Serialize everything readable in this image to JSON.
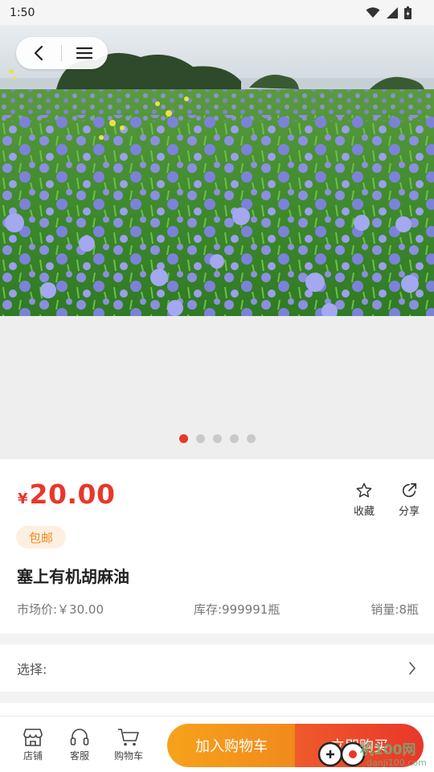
{
  "status_bar": {
    "time": "1:50",
    "icons": [
      "wifi-icon",
      "signal-icon",
      "battery-icon"
    ]
  },
  "gallery": {
    "image_count": 5,
    "active_index": 0,
    "image_desc": "flax-field-photo"
  },
  "nav": {
    "back_icon": "chevron-left-icon",
    "menu_icon": "hamburger-icon"
  },
  "product": {
    "currency": "¥",
    "price": "20.00",
    "tag": "包邮",
    "title": "塞上有机胡麻油",
    "market_price": "市场价:￥30.00",
    "stock": "库存:999991瓶",
    "sales": "销量:8瓶"
  },
  "actions": {
    "favorite_label": "收藏",
    "share_label": "分享"
  },
  "select_row": {
    "label": "选择:"
  },
  "bottom_bar": {
    "store_label": "店铺",
    "service_label": "客服",
    "cart_label": "购物车",
    "add_to_cart": "加入购物车",
    "buy_now": "立即购买"
  },
  "watermark": {
    "text": "机100网",
    "sub": "danji100.com"
  },
  "colors": {
    "accent": "#e8372a",
    "orange": "#f08a1c",
    "tag_bg": "#fdf0e1"
  }
}
